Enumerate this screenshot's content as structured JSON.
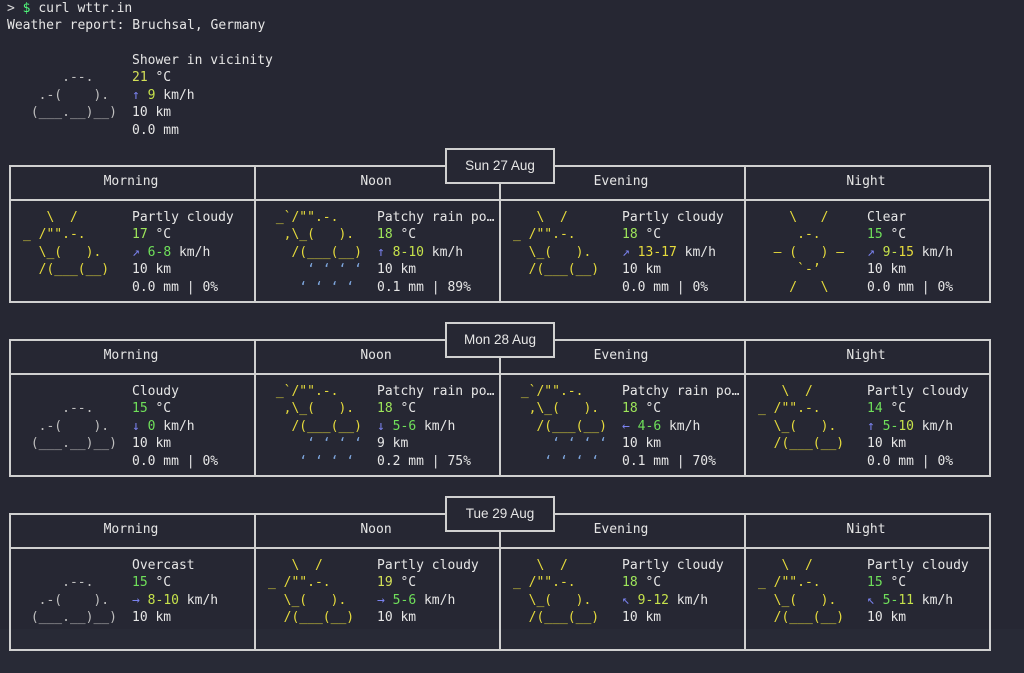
{
  "terminal": {
    "prompt_symbol": ">",
    "prompt_dollar": "$",
    "command": "curl wttr.in",
    "report_title": "Weather report: Bruchsal, Germany"
  },
  "current": {
    "art": [
      "",
      "     .--.    ",
      "  .-(    ).  ",
      " (___.__)__) ",
      ""
    ],
    "art_color": "grey",
    "condition": "Shower in vicinity",
    "temp": "21",
    "temp_unit": " °C",
    "temp_class": "t-warm",
    "wind_arrow": "↑",
    "wind_parts": [
      {
        "text": "9",
        "cls": "w-mid"
      }
    ],
    "wind_unit": " km/h",
    "visibility": "10 km",
    "precip": "0.0 mm"
  },
  "days": [
    {
      "date": "Sun 27 Aug",
      "periods": [
        {
          "name": "Morning",
          "art": [
            "   \\  /      ",
            "_ /\"\".-.    ",
            "  \\_(   ).  ",
            "  /(___(__) ",
            ""
          ],
          "art_color": "yellow",
          "rain": false,
          "condition": "Partly cloudy",
          "temp": "17",
          "temp_class": "t-mild",
          "wind_arrow": "↗",
          "wind_parts": [
            {
              "text": "6",
              "cls": "w-low"
            },
            {
              "text": "-",
              "cls": "w-low"
            },
            {
              "text": "8",
              "cls": "w-low"
            }
          ],
          "visibility": "10 km",
          "precip": "0.0 mm | 0%"
        },
        {
          "name": "Noon",
          "art": [
            " _`/\"\".-.    ",
            "  ,\\_(   ).  ",
            "   /(___(__) ",
            "     ‘ ‘ ‘ ‘ ",
            "    ‘ ‘ ‘ ‘  "
          ],
          "art_color": "yellow",
          "rain": true,
          "condition": "Patchy rain po…",
          "temp": "18",
          "temp_class": "t-mild",
          "wind_arrow": "↑",
          "wind_parts": [
            {
              "text": "8",
              "cls": "w-mid"
            },
            {
              "text": "-",
              "cls": "w-mid"
            },
            {
              "text": "10",
              "cls": "w-mid"
            }
          ],
          "visibility": "10 km",
          "precip": "0.1 mm | 89%"
        },
        {
          "name": "Evening",
          "art": [
            "   \\  /      ",
            "_ /\"\".-.    ",
            "  \\_(   ).  ",
            "  /(___(__) ",
            ""
          ],
          "art_color": "yellow",
          "rain": false,
          "condition": "Partly cloudy",
          "temp": "18",
          "temp_class": "t-mild",
          "wind_arrow": "↗",
          "wind_parts": [
            {
              "text": "13",
              "cls": "w-high"
            },
            {
              "text": "-",
              "cls": "w-high"
            },
            {
              "text": "17",
              "cls": "w-high"
            }
          ],
          "visibility": "10 km",
          "precip": "0.0 mm | 0%"
        },
        {
          "name": "Night",
          "art": [
            "    \\   /    ",
            "     .-.     ",
            "  ― (   ) ―  ",
            "     `-’     ",
            "    /   \\    "
          ],
          "art_color": "yellow",
          "rain": false,
          "condition": "Clear",
          "temp": "15",
          "temp_class": "t-cool",
          "wind_arrow": "↗",
          "wind_parts": [
            {
              "text": "9",
              "cls": "w-mid"
            },
            {
              "text": "-",
              "cls": "w-mid"
            },
            {
              "text": "15",
              "cls": "w-high"
            }
          ],
          "visibility": "10 km",
          "precip": "0.0 mm | 0%"
        }
      ]
    },
    {
      "date": "Mon 28 Aug",
      "periods": [
        {
          "name": "Morning",
          "art": [
            "",
            "     .--.    ",
            "  .-(    ).  ",
            " (___.__)__) ",
            ""
          ],
          "art_color": "grey",
          "rain": false,
          "condition": "Cloudy",
          "temp": "15",
          "temp_class": "t-cool",
          "wind_arrow": "↓",
          "wind_parts": [
            {
              "text": "0",
              "cls": "w-low"
            }
          ],
          "visibility": "10 km",
          "precip": "0.0 mm | 0%"
        },
        {
          "name": "Noon",
          "art": [
            " _`/\"\".-.    ",
            "  ,\\_(   ).  ",
            "   /(___(__) ",
            "     ‘ ‘ ‘ ‘ ",
            "    ‘ ‘ ‘ ‘  "
          ],
          "art_color": "yellow",
          "rain": true,
          "condition": "Patchy rain po…",
          "temp": "18",
          "temp_class": "t-mild",
          "wind_arrow": "↓",
          "wind_parts": [
            {
              "text": "5",
              "cls": "w-low"
            },
            {
              "text": "-",
              "cls": "w-low"
            },
            {
              "text": "6",
              "cls": "w-low"
            }
          ],
          "visibility": "9 km",
          "precip": "0.2 mm | 75%"
        },
        {
          "name": "Evening",
          "art": [
            " _`/\"\".-.    ",
            "  ,\\_(   ).  ",
            "   /(___(__) ",
            "     ‘ ‘ ‘ ‘ ",
            "    ‘ ‘ ‘ ‘  "
          ],
          "art_color": "yellow",
          "rain": true,
          "condition": "Patchy rain po…",
          "temp": "18",
          "temp_class": "t-mild",
          "wind_arrow": "←",
          "wind_parts": [
            {
              "text": "4",
              "cls": "w-low"
            },
            {
              "text": "-",
              "cls": "w-low"
            },
            {
              "text": "6",
              "cls": "w-low"
            }
          ],
          "visibility": "10 km",
          "precip": "0.1 mm | 70%"
        },
        {
          "name": "Night",
          "art": [
            "   \\  /      ",
            "_ /\"\".-.    ",
            "  \\_(   ).  ",
            "  /(___(__) ",
            ""
          ],
          "art_color": "yellow",
          "rain": false,
          "condition": "Partly cloudy",
          "temp": "14",
          "temp_class": "t-cool",
          "wind_arrow": "↑",
          "wind_parts": [
            {
              "text": "5",
              "cls": "w-low"
            },
            {
              "text": "-",
              "cls": "w-low"
            },
            {
              "text": "10",
              "cls": "w-mid"
            }
          ],
          "visibility": "10 km",
          "precip": "0.0 mm | 0%"
        }
      ]
    },
    {
      "date": "Tue 29 Aug",
      "periods": [
        {
          "name": "Morning",
          "art": [
            "",
            "     .--.    ",
            "  .-(    ).  ",
            " (___.__)__) ",
            ""
          ],
          "art_color": "grey",
          "rain": false,
          "condition": "Overcast",
          "temp": "15",
          "temp_class": "t-cool",
          "wind_arrow": "→",
          "wind_parts": [
            {
              "text": "8",
              "cls": "w-mid"
            },
            {
              "text": "-",
              "cls": "w-mid"
            },
            {
              "text": "10",
              "cls": "w-mid"
            }
          ],
          "visibility": "10 km",
          "precip": ""
        },
        {
          "name": "Noon",
          "art": [
            "   \\  /      ",
            "_ /\"\".-.    ",
            "  \\_(   ).  ",
            "  /(___(__) ",
            ""
          ],
          "art_color": "yellow",
          "rain": false,
          "condition": "Partly cloudy",
          "temp": "19",
          "temp_class": "t-warm",
          "wind_arrow": "→",
          "wind_parts": [
            {
              "text": "5",
              "cls": "w-low"
            },
            {
              "text": "-",
              "cls": "w-low"
            },
            {
              "text": "6",
              "cls": "w-low"
            }
          ],
          "visibility": "10 km",
          "precip": ""
        },
        {
          "name": "Evening",
          "art": [
            "   \\  /      ",
            "_ /\"\".-.    ",
            "  \\_(   ).  ",
            "  /(___(__) ",
            ""
          ],
          "art_color": "yellow",
          "rain": false,
          "condition": "Partly cloudy",
          "temp": "18",
          "temp_class": "t-mild",
          "wind_arrow": "↖",
          "wind_parts": [
            {
              "text": "9",
              "cls": "w-mid"
            },
            {
              "text": "-",
              "cls": "w-mid"
            },
            {
              "text": "12",
              "cls": "w-mid"
            }
          ],
          "visibility": "10 km",
          "precip": ""
        },
        {
          "name": "Night",
          "art": [
            "   \\  /      ",
            "_ /\"\".-.    ",
            "  \\_(   ).  ",
            "  /(___(__) ",
            ""
          ],
          "art_color": "yellow",
          "rain": false,
          "condition": "Partly cloudy",
          "temp": "15",
          "temp_class": "t-cool",
          "wind_arrow": "↖",
          "wind_parts": [
            {
              "text": "5",
              "cls": "w-low"
            },
            {
              "text": "-",
              "cls": "w-low"
            },
            {
              "text": "11",
              "cls": "w-mid"
            }
          ],
          "visibility": "10 km",
          "precip": ""
        }
      ]
    }
  ],
  "labels": {
    "temp_unit": " °C",
    "wind_unit": " km/h"
  }
}
